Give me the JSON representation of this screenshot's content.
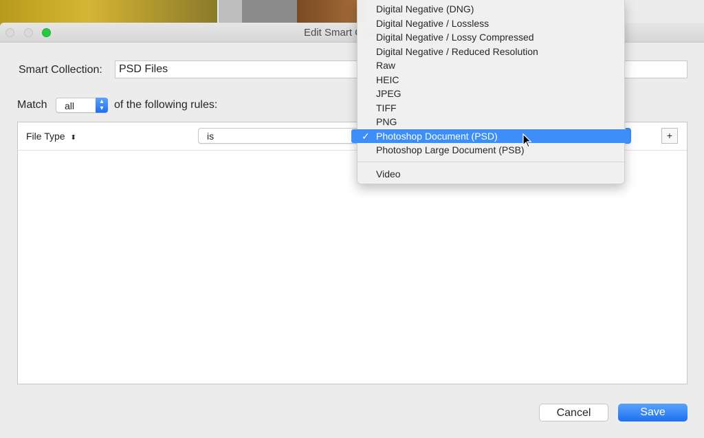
{
  "window": {
    "title": "Edit Smart Collection"
  },
  "form": {
    "name_label": "Smart Collection:",
    "name_value": "PSD Files",
    "match_label": "Match",
    "match_value": "all",
    "match_suffix": "of the following rules:"
  },
  "rule": {
    "field": "File Type",
    "operator": "is",
    "add_label": "+"
  },
  "menu": {
    "items": [
      "Digital Negative (DNG)",
      "Digital Negative / Lossless",
      "Digital Negative / Lossy Compressed",
      "Digital Negative / Reduced Resolution",
      "Raw",
      "HEIC",
      "JPEG",
      "TIFF",
      "PNG",
      "Photoshop Document (PSD)",
      "Photoshop Large Document (PSB)"
    ],
    "after_separator": "Video",
    "selected": "Photoshop Document (PSD)",
    "check": "✓"
  },
  "buttons": {
    "cancel": "Cancel",
    "save": "Save"
  },
  "colors": {
    "accent": "#3d8ef6",
    "close": "#d9d9d9",
    "zoom": "#27c93f"
  }
}
